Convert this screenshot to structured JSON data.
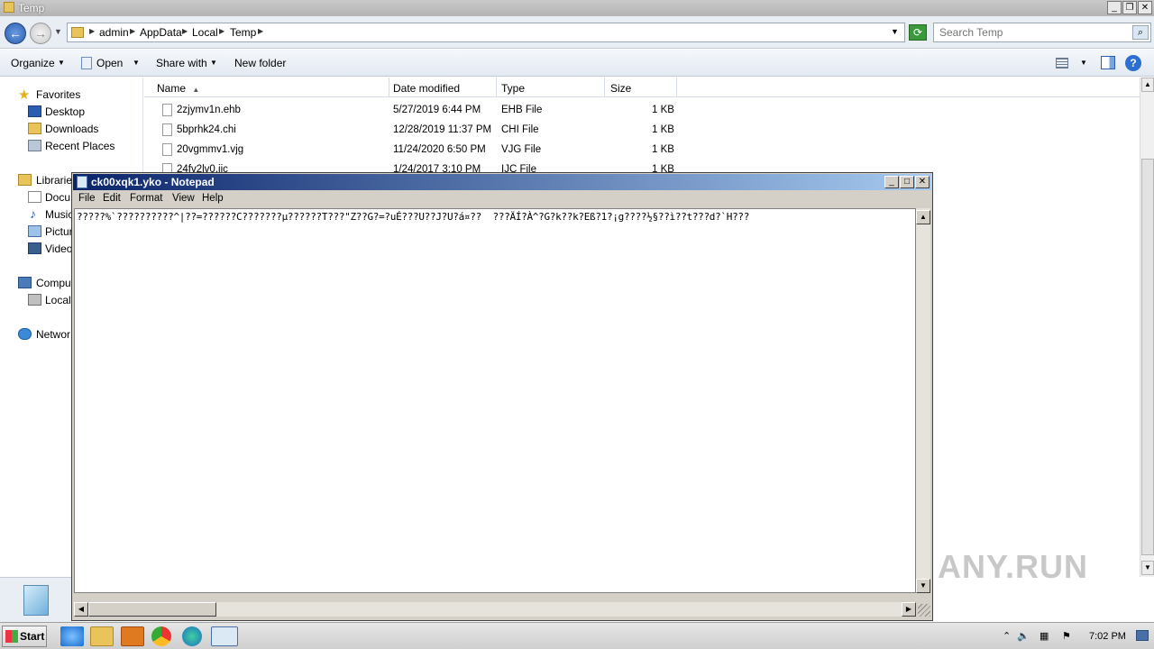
{
  "explorer": {
    "title": "Temp",
    "breadcrumb": [
      "admin",
      "AppData",
      "Local",
      "Temp"
    ],
    "search_placeholder": "Search Temp",
    "toolbar": {
      "organize": "Organize",
      "open": "Open",
      "share_with": "Share with",
      "new_folder": "New folder"
    },
    "nav": {
      "favorites": "Favorites",
      "desktop": "Desktop",
      "downloads": "Downloads",
      "recent_places": "Recent Places",
      "libraries": "Librarie",
      "documents": "Docu",
      "music": "Music",
      "pictures": "Pictur",
      "videos": "Video",
      "computer": "Comput",
      "local_disk": "Local",
      "network": "Networ"
    },
    "columns": {
      "name": "Name",
      "date_modified": "Date modified",
      "type": "Type",
      "size": "Size"
    },
    "files": [
      {
        "name": "2zjymv1n.ehb",
        "date": "5/27/2019 6:44 PM",
        "type": "EHB File",
        "size": "1 KB"
      },
      {
        "name": "5bprhk24.chi",
        "date": "12/28/2019 11:37 PM",
        "type": "CHI File",
        "size": "1 KB"
      },
      {
        "name": "20vgmmv1.vjg",
        "date": "11/24/2020 6:50 PM",
        "type": "VJG File",
        "size": "1 KB"
      },
      {
        "name": "24fv2lv0.ijc",
        "date": "1/24/2017 3:10 PM",
        "type": "IJC File",
        "size": "1 KB"
      }
    ]
  },
  "notepad": {
    "title": "ck00xqk1.yko - Notepad",
    "menu": {
      "file": "File",
      "edit": "Edit",
      "format": "Format",
      "view": "View",
      "help": "Help"
    },
    "content": "?????%`??????????^|??=??????C???????µ??????T???\"Z??G?=?uÉ???U??J?U?á¤??  ???ÄÍ?À^?G?k??k?Eß?1?¡g????½§??ì??t???d?`H???"
  },
  "watermark": "ANY.RUN",
  "taskbar": {
    "start": "Start",
    "clock": "7:02 PM"
  }
}
